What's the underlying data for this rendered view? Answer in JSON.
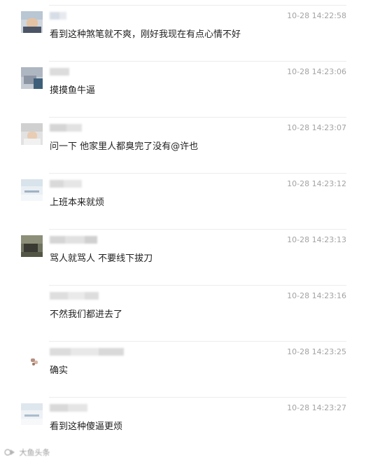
{
  "comments": [
    {
      "time": "10-28 14:22:58",
      "text": "看到这种煞笔就不爽，刚好我现在有点心情不好"
    },
    {
      "time": "10-28 14:23:06",
      "text": "摸摸鱼牛逼"
    },
    {
      "time": "10-28 14:23:07",
      "text": "问一下 他家里人都臭完了没有@许也"
    },
    {
      "time": "10-28 14:23:12",
      "text": "上班本来就烦"
    },
    {
      "time": "10-28 14:23:13",
      "text": "骂人就骂人 不要线下拔刀"
    },
    {
      "time": "10-28 14:23:16",
      "text": "不然我们都进去了"
    },
    {
      "time": "10-28 14:23:25",
      "text": "确实"
    },
    {
      "time": "10-28 14:23:27",
      "text": "看到这种傻逼更烦"
    }
  ],
  "watermark": {
    "label": "大鱼头条"
  },
  "colors": {
    "timestamp": "#a3a3a3",
    "divider": "#ececec",
    "text": "#1f1f1f"
  }
}
